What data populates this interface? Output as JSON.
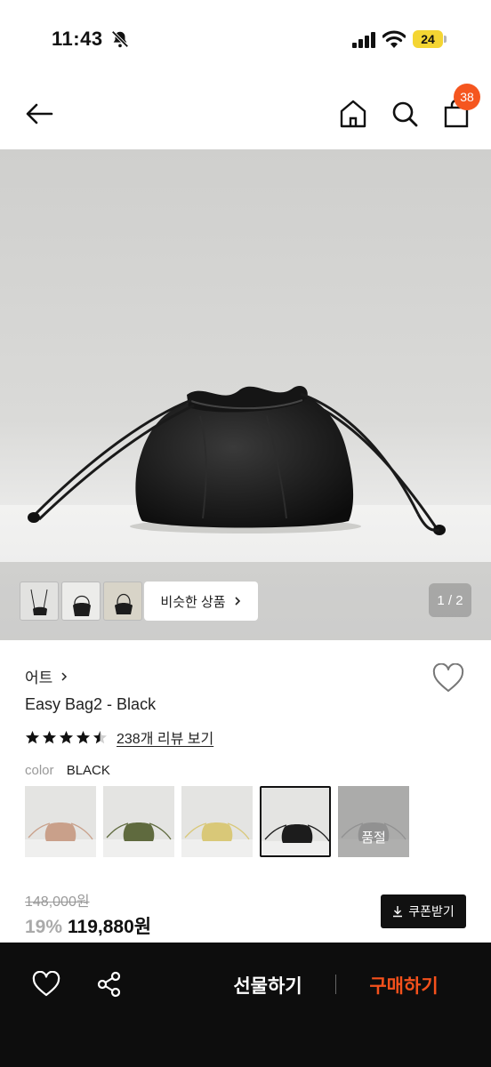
{
  "status_bar": {
    "time": "11:43",
    "battery": "24"
  },
  "header": {
    "cart_count": "38"
  },
  "gallery": {
    "similar_label": "비슷한 상품",
    "page_indicator": "1 / 2"
  },
  "product": {
    "brand": "어트",
    "name": "Easy Bag2 - Black",
    "rating": 4.5,
    "review_link": "238개 리뷰 보기",
    "color_label": "color",
    "color_value": "BLACK",
    "swatches": [
      {
        "color": "#c9a08a"
      },
      {
        "color": "#5f6a3e"
      },
      {
        "color": "#d9c878"
      },
      {
        "color": "#1c1c1c"
      },
      {
        "color": "#9a9a9a",
        "overlay": "품절"
      }
    ],
    "original_price": "148,000원",
    "discount": "19%",
    "price": "119,880원",
    "coupon_label": "쿠폰받기"
  },
  "bottom_bar": {
    "gift_label": "선물하기",
    "buy_label": "구매하기"
  },
  "colors": {
    "accent": "#f5561f",
    "buy": "#f5511c",
    "dark": "#0d0d0d"
  }
}
